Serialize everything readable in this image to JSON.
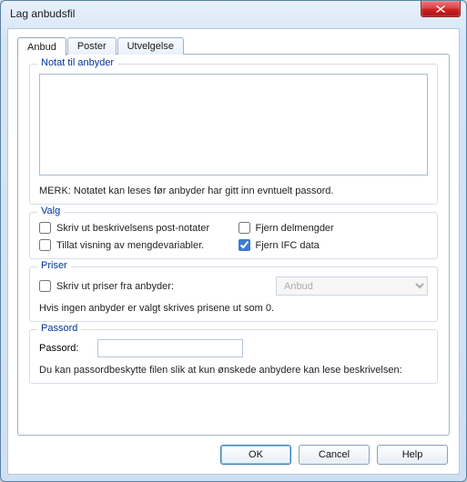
{
  "window": {
    "title": "Lag anbudsfil"
  },
  "tabs": {
    "anbud": "Anbud",
    "poster": "Poster",
    "utvelgelse": "Utvelgelse"
  },
  "notat": {
    "legend": "Notat til anbyder",
    "value": "",
    "merk": "MERK: Notatet kan leses før anbyder har gitt inn evntuelt passord."
  },
  "valg": {
    "legend": "Valg",
    "skriv_post_notater": "Skriv ut beskrivelsens post-notater",
    "fjern_delmengder": "Fjern delmengder",
    "tillat_mengdevariabler": "Tillat visning av mengdevariabler.",
    "fjern_ifc": "Fjern IFC data"
  },
  "priser": {
    "legend": "Priser",
    "skriv_priser": "Skriv ut priser fra anbyder:",
    "combo_value": "Anbud",
    "hint": "Hvis ingen anbyder er valgt skrives prisene ut som 0."
  },
  "passord": {
    "legend": "Passord",
    "label": "Passord:",
    "value": "",
    "hint": "Du kan passordbeskytte filen slik at kun ønskede anbydere kan lese beskrivelsen:"
  },
  "buttons": {
    "ok": "OK",
    "cancel": "Cancel",
    "help": "Help"
  }
}
